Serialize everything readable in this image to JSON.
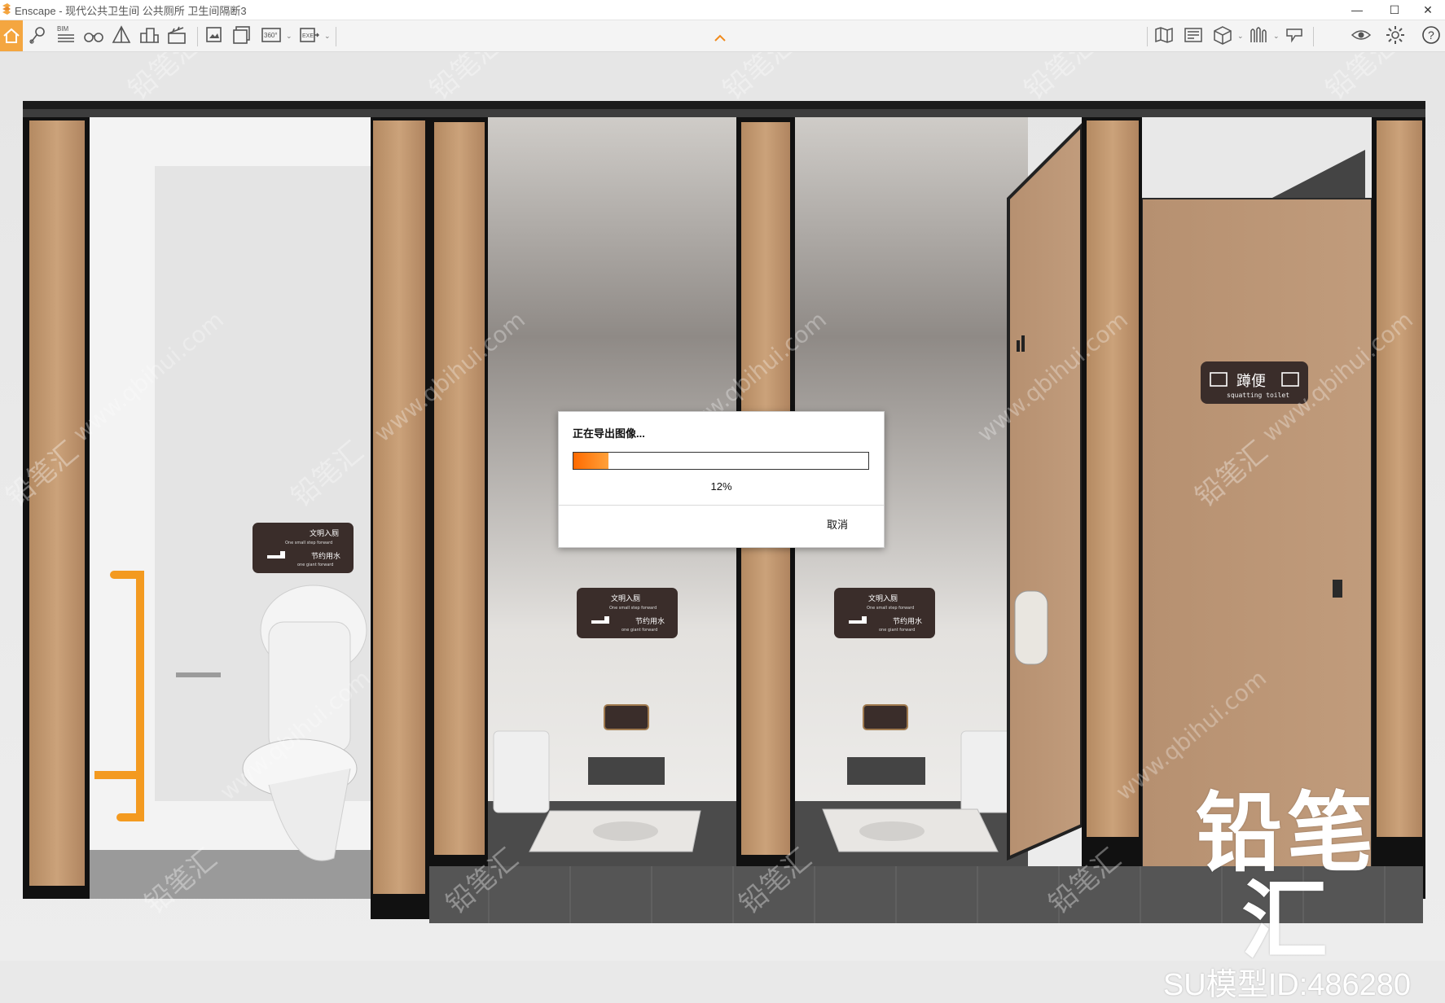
{
  "window": {
    "app_name": "Enscape",
    "title": "Enscape - 现代公共卫生间 公共厕所 卫生间隔断3",
    "minimize": "—",
    "maximize": "☐",
    "close": "✕"
  },
  "toolbar": {
    "left_icons": [
      "home-icon",
      "location-pin-icon",
      "bim-icon",
      "binoculars-icon",
      "pyramid-icon",
      "buildings-icon",
      "clapperboard-icon",
      "screenshot-icon",
      "batch-render-icon",
      "panorama-360-icon",
      "exe-export-icon"
    ],
    "bim_label": "BIM",
    "pano_label": "360°",
    "exe_label": "EXE",
    "right_icons": [
      "map-icon",
      "render-settings-icon",
      "cube-icon",
      "asset-library-icon",
      "visual-settings-icon",
      "eye-icon",
      "gear-icon",
      "help-icon"
    ],
    "help_label": "?"
  },
  "scene": {
    "sign_civil_cn": "文明入厕",
    "sign_civil_en": "One small step forward",
    "sign_water_cn": "节约用水",
    "sign_water_en": "one giant forward",
    "sign_squat_cn": "蹲便",
    "sign_squat_en": "squatting toilet",
    "watermark_cn": "铅笔汇",
    "watermark_url": "www.qbihui.com"
  },
  "dialog": {
    "title": "正在导出图像...",
    "progress": 0.12,
    "progress_label": "12%",
    "cancel_label": "取消"
  },
  "brand": {
    "name": "铅笔汇",
    "model_id": "SU模型ID:486280"
  },
  "colors": {
    "accent": "#f4a640",
    "progress": "#ff7a10",
    "wood": "#c49a72",
    "sign": "#3a2d2a"
  }
}
